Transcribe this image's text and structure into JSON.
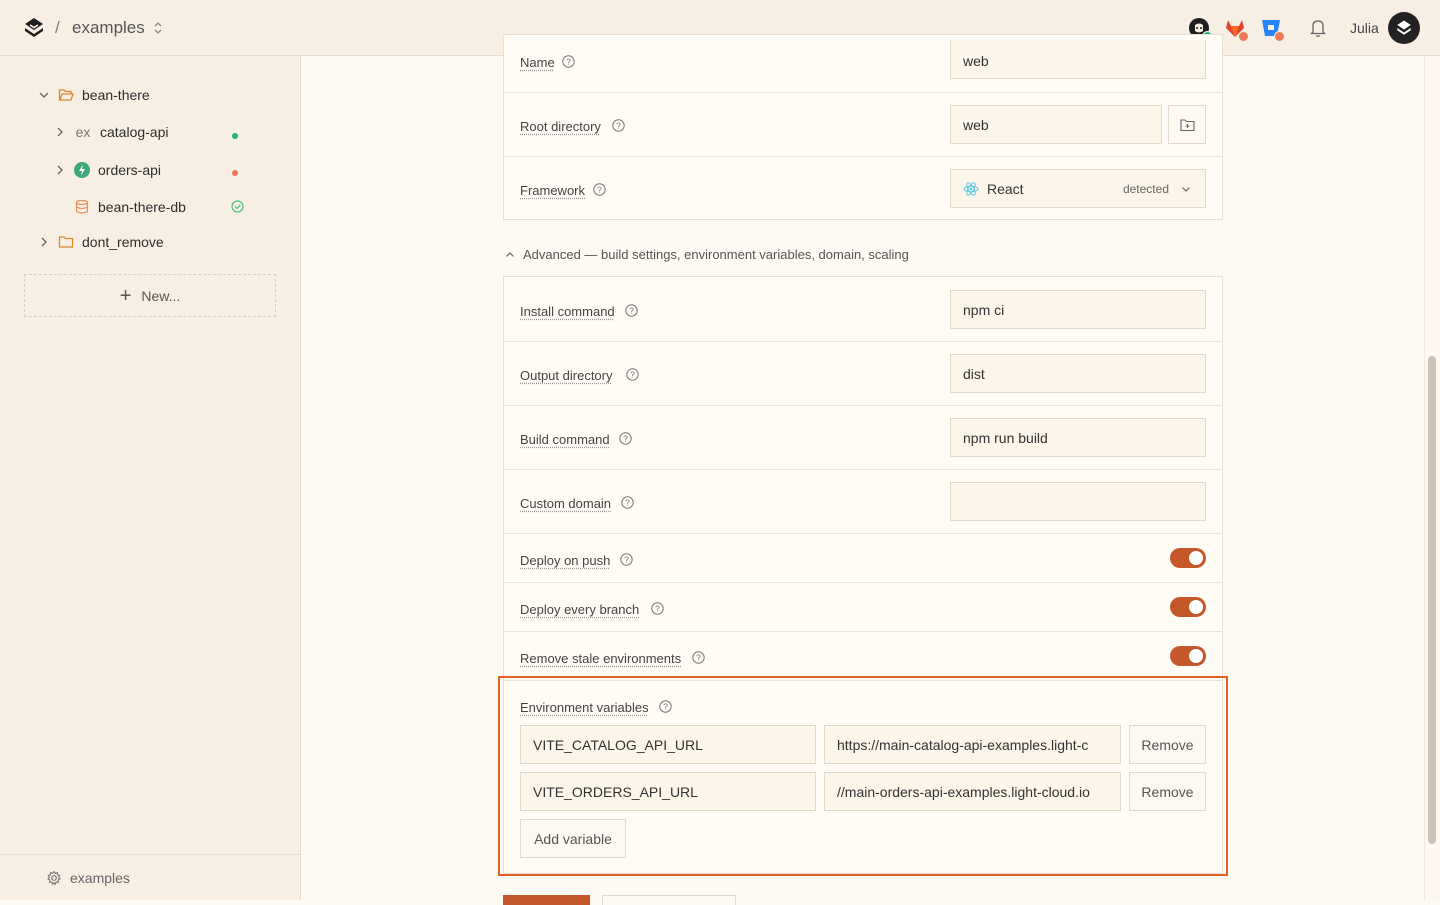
{
  "header": {
    "slash": "/",
    "project": "examples",
    "user": "Julia"
  },
  "sidebar": {
    "tree": [
      {
        "label": "bean-there",
        "type": "folder",
        "expanded": true
      },
      {
        "label": "catalog-api",
        "type": "service",
        "status": "green"
      },
      {
        "label": "orders-api",
        "type": "service",
        "status": "orange"
      },
      {
        "label": "bean-there-db",
        "type": "database",
        "status": "ok"
      },
      {
        "label": "dont_remove",
        "type": "folder",
        "expanded": false
      }
    ],
    "catalog_prefix": "ex",
    "new_label": "New...",
    "footer_label": "examples"
  },
  "form": {
    "name": {
      "label": "Name",
      "value": "web"
    },
    "root_directory": {
      "label": "Root directory",
      "value": "web"
    },
    "framework": {
      "label": "Framework",
      "value": "React",
      "status": "detected"
    },
    "advanced_toggle": "Advanced — build settings, environment variables, domain, scaling",
    "install_command": {
      "label": "Install command",
      "value": "npm ci"
    },
    "output_directory": {
      "label": "Output directory",
      "value": "dist"
    },
    "build_command": {
      "label": "Build command",
      "value": "npm run build"
    },
    "custom_domain": {
      "label": "Custom domain",
      "value": ""
    },
    "deploy_on_push": {
      "label": "Deploy on push",
      "on": true
    },
    "deploy_every_branch": {
      "label": "Deploy every branch",
      "on": true
    },
    "remove_stale": {
      "label": "Remove stale environments",
      "on": true
    },
    "env": {
      "label": "Environment variables",
      "vars": [
        {
          "key": "VITE_CATALOG_API_URL",
          "value": "https://main-catalog-api-examples.light-c",
          "remove": "Remove"
        },
        {
          "key": "VITE_ORDERS_API_URL",
          "value": "//main-orders-api-examples.light-cloud.io",
          "remove": "Remove"
        }
      ],
      "add_label": "Add variable"
    }
  },
  "colors": {
    "accent": "#c4582a",
    "highlight": "#e0641f",
    "status_green": "#1fb877",
    "status_orange": "#ec7a54"
  },
  "icons": {
    "github": "github-icon",
    "gitlab": "gitlab-icon",
    "bitbucket": "bitbucket-icon",
    "notifications": "bell-icon"
  }
}
